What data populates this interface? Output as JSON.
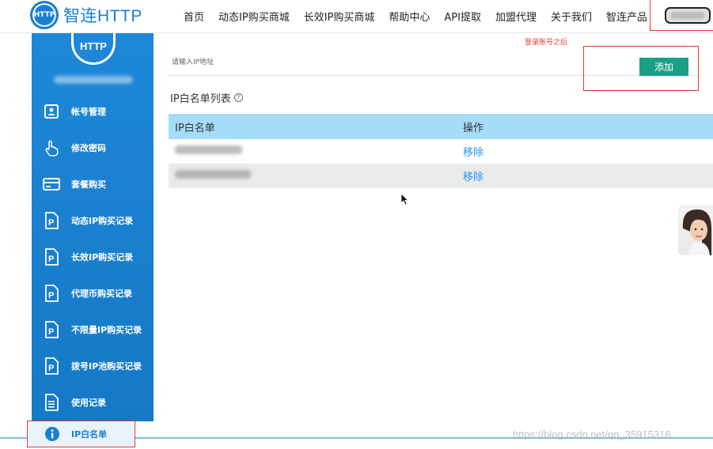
{
  "header": {
    "logo_badge": "HTTP",
    "logo_text": "智连HTTP",
    "nav": [
      "首页",
      "动态IP购买商城",
      "长效IP购买商城",
      "帮助中心",
      "API提取",
      "加盟代理",
      "关于我们",
      "智连产品"
    ]
  },
  "sidebar": {
    "logo_text": "HTTP",
    "items": [
      {
        "label": "帐号管理",
        "icon": "user-card-icon"
      },
      {
        "label": "修改密码",
        "icon": "hand-pointer-icon"
      },
      {
        "label": "套餐购买",
        "icon": "credit-card-icon"
      },
      {
        "label": "动态IP购买记录",
        "icon": "p-document-icon"
      },
      {
        "label": "长效IP购买记录",
        "icon": "p-document-icon"
      },
      {
        "label": "代理币购买记录",
        "icon": "p-document-icon"
      },
      {
        "label": "不限量IP购买记录",
        "icon": "p-document-icon"
      },
      {
        "label": "拨号IP池购买记录",
        "icon": "p-document-icon"
      },
      {
        "label": "使用记录",
        "icon": "document-lines-icon"
      }
    ],
    "active_item": {
      "label": "IP白名单",
      "icon": "info-icon"
    }
  },
  "main": {
    "annotation": "登录账号之后",
    "input_placeholder": "请输入IP地址",
    "add_button": "添加",
    "list_title": "IP白名单列表",
    "help_glyph": "?",
    "table": {
      "headers": [
        "IP白名单",
        "操作"
      ],
      "rows": [
        {
          "action": "移除"
        },
        {
          "action": "移除"
        }
      ]
    }
  },
  "watermark": "https://blog.csdn.net/qq_35915318",
  "colors": {
    "brand_blue": "#1a7fd4",
    "add_green": "#1aa085",
    "table_header": "#a5dcf7",
    "annotation_red": "#e53935",
    "link_blue": "#2196f3"
  }
}
